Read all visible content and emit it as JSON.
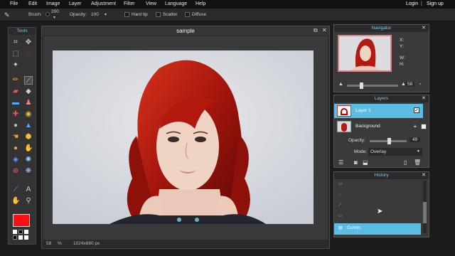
{
  "menu": {
    "items": [
      "File",
      "Edit",
      "Image",
      "Layer",
      "Adjustment",
      "Filter",
      "View",
      "Language",
      "Help"
    ],
    "login": "Login",
    "signup": "Sign up"
  },
  "options": {
    "brush_label": "Brush:",
    "brush_size": "200",
    "opacity_label": "Opacity:",
    "opacity_value": "100",
    "hard_tip": "Hard tip",
    "scatter": "Scatter",
    "diffuse": "Diffuse"
  },
  "tools": {
    "title": "Tools",
    "foreground_color": "#ff0f0f"
  },
  "canvas": {
    "title": "sample",
    "zoom": "58",
    "zoom_unit": "%",
    "dimensions": "1024x680 px"
  },
  "navigator": {
    "title": "Navigator",
    "x_label": "X:",
    "y_label": "Y:",
    "w_label": "W:",
    "h_label": "H:",
    "zoom_value": "58",
    "zoom_level": 0.25
  },
  "layers": {
    "title": "Layers",
    "items": [
      {
        "name": "Layer 1",
        "selected": true
      },
      {
        "name": "Background",
        "selected": false
      }
    ],
    "opacity_label": "Opacity:",
    "opacity_value": "49",
    "opacity_level": 0.49,
    "mode_label": "Mode:",
    "mode_value": "Overlay"
  },
  "history": {
    "title": "History",
    "current": "Curves"
  },
  "colors": {
    "accent": "#7ec8ea",
    "selection": "#5bbde4",
    "foreground": "#ff0f0f"
  }
}
